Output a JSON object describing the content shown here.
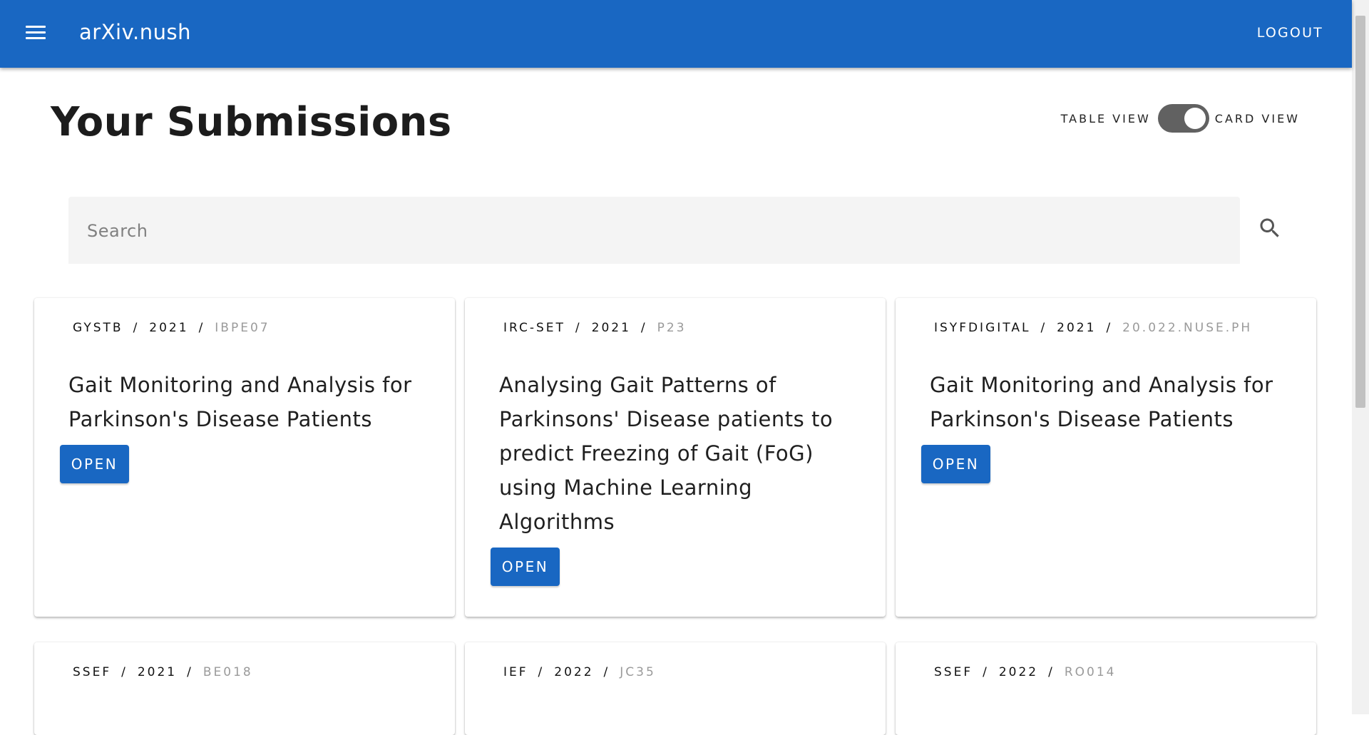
{
  "header": {
    "app_title": "arXiv.nush",
    "logout_label": "LOGOUT"
  },
  "page": {
    "title": "Your Submissions"
  },
  "view_toggle": {
    "left_label": "TABLE VIEW",
    "right_label": "CARD VIEW",
    "selected": "CARD VIEW"
  },
  "search": {
    "placeholder": "Search",
    "value": ""
  },
  "cards": [
    {
      "competition": "GYSTB",
      "year": "2021",
      "code": "IBPE07",
      "title": "Gait Monitoring and Analysis for Parkinson's Disease Patients",
      "button": "OPEN"
    },
    {
      "competition": "IRC-SET",
      "year": "2021",
      "code": "P23",
      "title": "Analysing Gait Patterns of Parkinsons' Disease patients to predict Freezing of Gait (FoG) using Machine Learning Algorithms",
      "button": "OPEN"
    },
    {
      "competition": "ISYFDIGITAL",
      "year": "2021",
      "code": "20.022.NUSE.PH",
      "title": "Gait Monitoring and Analysis for Parkinson's Disease Patients",
      "button": "OPEN"
    },
    {
      "competition": "SSEF",
      "year": "2021",
      "code": "BE018"
    },
    {
      "competition": "IEF",
      "year": "2022",
      "code": "JC35"
    },
    {
      "competition": "SSEF",
      "year": "2022",
      "code": "RO014"
    }
  ],
  "colors": {
    "primary": "#1967c2",
    "toggle_track": "#616161",
    "meta_code": "#9a9a9a"
  },
  "icons": {
    "menu": "menu-icon",
    "search": "search-icon"
  }
}
